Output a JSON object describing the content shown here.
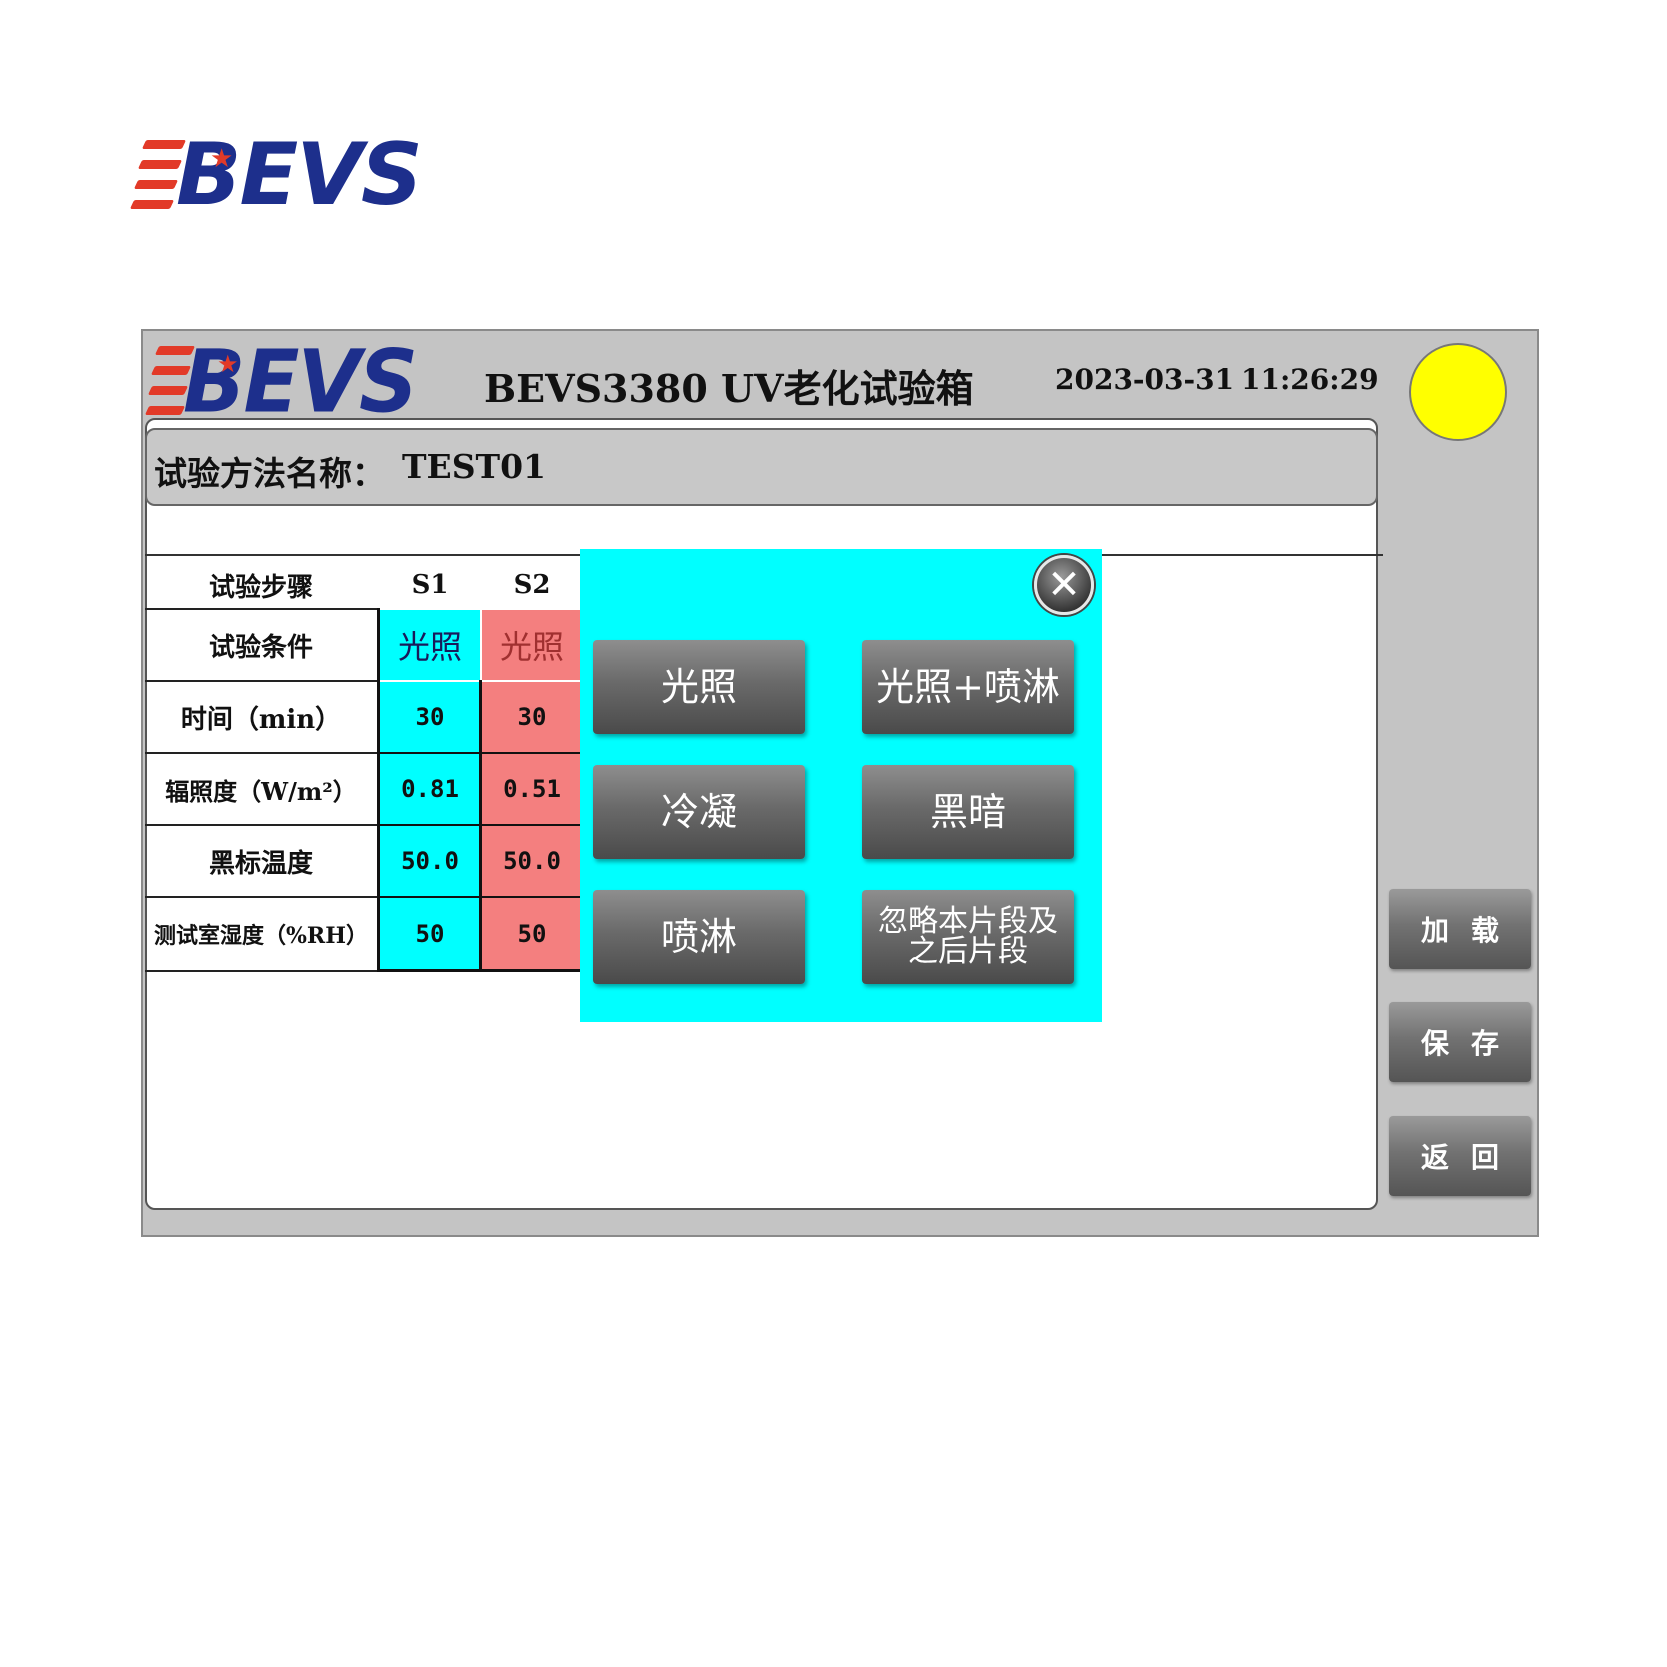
{
  "brand": {
    "logo_text": "BEVS",
    "logo_red": "#e23a28",
    "logo_blue": "#1d2f8c"
  },
  "header": {
    "title": "BEVS3380  UV老化试验箱",
    "date": "2023-03-31",
    "time": "11:26:29",
    "status_color": "#ffff00"
  },
  "method": {
    "label": "试验方法名称：",
    "value": "TEST01"
  },
  "table": {
    "steps_label": "试验步骤",
    "columns": [
      "S1",
      "S2"
    ],
    "rows": [
      {
        "label": "试验条件",
        "values": [
          "光照",
          "光照"
        ]
      },
      {
        "label": "时间（min）",
        "values": [
          "30",
          "30"
        ]
      },
      {
        "label": "辐照度（W/m²）",
        "values": [
          "0.81",
          "0.51"
        ]
      },
      {
        "label": "黑标温度",
        "values": [
          "50.0",
          "50.0"
        ]
      },
      {
        "label": "测试室湿度（%RH）",
        "values": [
          "50",
          "50"
        ]
      }
    ],
    "s1_color": "#00ffff",
    "s2_color": "#f47f7f"
  },
  "popup": {
    "buttons": [
      "光照",
      "光照+喷淋",
      "冷凝",
      "黑暗",
      "喷淋",
      "忽略本片段及之后片段"
    ],
    "close_icon": "close-icon",
    "background": "#00ffff"
  },
  "side_buttons": [
    "加载",
    "保存",
    "返回"
  ]
}
